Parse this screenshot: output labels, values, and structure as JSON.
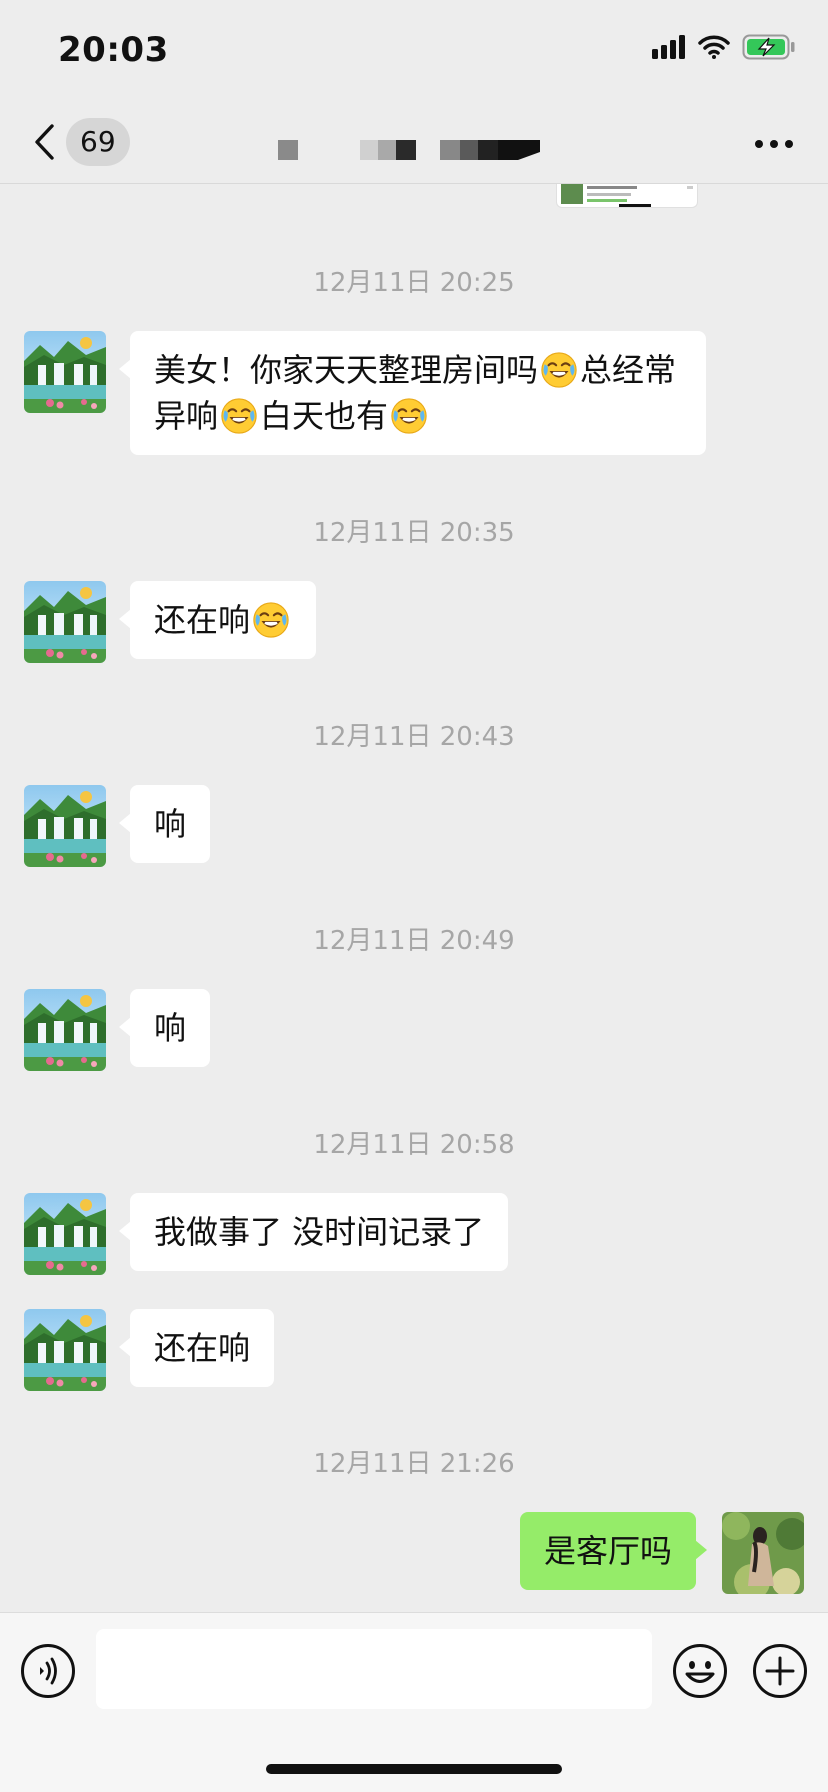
{
  "status_bar": {
    "time": "20:03"
  },
  "nav": {
    "unread_count": "69"
  },
  "messages": [
    {
      "timestamp": "12月11日 20:25",
      "direction": "in",
      "segments": [
        "美女！你家天天整理房间吗",
        "总经常异响",
        "白天也有"
      ]
    },
    {
      "timestamp": "12月11日 20:35",
      "direction": "in",
      "segments": [
        "还在响"
      ]
    },
    {
      "timestamp": "12月11日 20:43",
      "direction": "in",
      "text": "响"
    },
    {
      "timestamp": "12月11日 20:49",
      "direction": "in",
      "text": "响"
    },
    {
      "timestamp": "12月11日 20:58",
      "direction": "in",
      "text": "我做事了 没时间记录了"
    },
    {
      "direction": "in",
      "text": "还在响"
    },
    {
      "timestamp": "12月11日 21:26",
      "direction": "out",
      "text": "是客厅吗"
    }
  ],
  "icons": {
    "back": "chevron-left-icon",
    "more": "ellipsis-icon",
    "voice": "voice-icon",
    "emoji": "smiley-icon",
    "plus": "plus-icon",
    "reaction_emoji": "laughing-crying-emoji"
  },
  "colors": {
    "background": "#ededed",
    "incoming_bubble": "#ffffff",
    "outgoing_bubble": "#95ec69",
    "timestamp": "#a6a6a6"
  }
}
